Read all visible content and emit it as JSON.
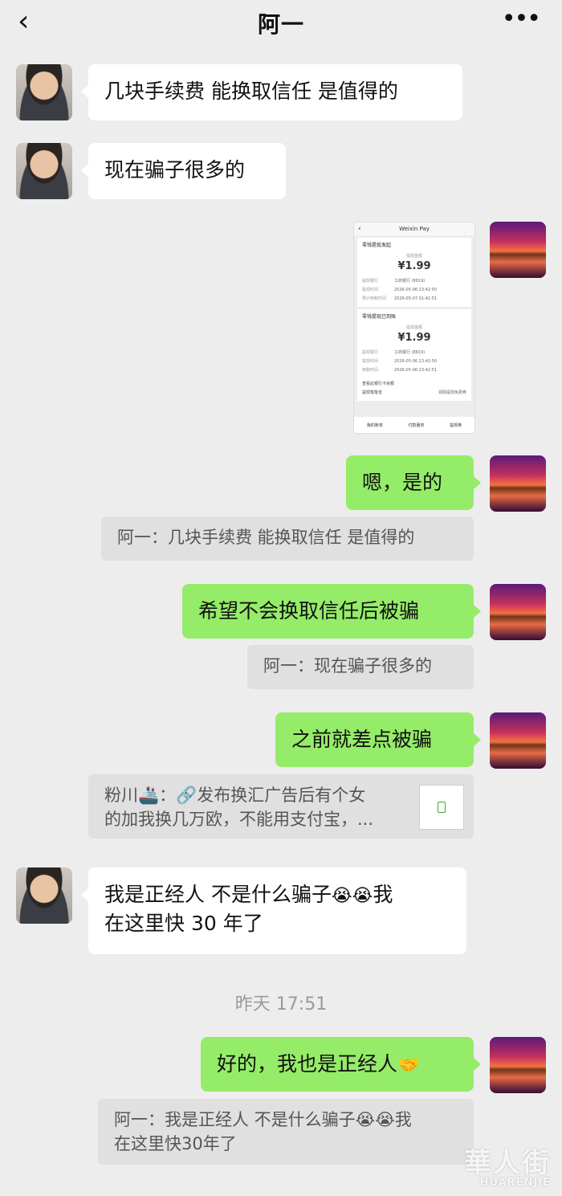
{
  "header": {
    "title": "阿一",
    "back_icon": "‹",
    "more_icon": "•••"
  },
  "messages": [
    {
      "id": "m1",
      "side": "in",
      "text": "几块手续费 能换取信任 是值得的"
    },
    {
      "id": "m2",
      "side": "in",
      "text": "现在骗子很多的"
    },
    {
      "id": "m4",
      "side": "out",
      "text": "嗯，是的"
    },
    {
      "id": "m5",
      "side": "out",
      "text": "希望不会换取信任后被骗"
    },
    {
      "id": "m6",
      "side": "out",
      "text": "之前就差点被骗"
    },
    {
      "id": "m7",
      "side": "in",
      "text_line1": "我是正经人 不是什么骗子",
      "emoji": "😭😭",
      "text_line1b": "我",
      "text_line2": "在这里快 30 年了"
    },
    {
      "id": "m8",
      "side": "out",
      "text": "好的，我也是正经人",
      "emoji": "🤝"
    }
  ],
  "quotes": {
    "q1": "阿一：几块手续费 能换取信任 是值得的",
    "q2": "阿一：现在骗子很多的",
    "q3_line1": "粉川🚢：🔗发布换汇广告后有个女",
    "q3_line2": "的加我换几万欧，不能用支付宝，...",
    "q4_line1": "阿一：我是正经人 不是什么骗子😭😭我",
    "q4_line2": "在这里快30年了"
  },
  "timestamp": "昨天 17:51",
  "screenshot": {
    "bar_title": "Weixin Pay",
    "card1_title": "零钱提现发起",
    "card1_label": "提现金额",
    "card1_amount": "¥1.99",
    "card1_rows": [
      {
        "k": "提现银行",
        "v": "工商银行 (8819)"
      },
      {
        "k": "提现时间",
        "v": "2026-05-06 23:42:50"
      },
      {
        "k": "预计到账时间",
        "v": "2026-05-07 01:42:51"
      }
    ],
    "card2_title": "零钱提现已到账",
    "card2_label": "提现金额",
    "card2_amount": "¥1.99",
    "card2_rows": [
      {
        "k": "提现银行",
        "v": "工商银行 (8819)"
      },
      {
        "k": "提现时间",
        "v": "2026-05-06 23:42:50"
      },
      {
        "k": "到账时间",
        "v": "2026-05-06 23:42:51"
      }
    ],
    "link1": "查看此银行卡余额",
    "link2": "提现笔笔省",
    "link2_right": "领取提现免费券",
    "footer": [
      "我的账单",
      "付款服务",
      "提现券"
    ]
  },
  "watermark": {
    "main": "華人街",
    "sub": "HUARENJIE"
  }
}
